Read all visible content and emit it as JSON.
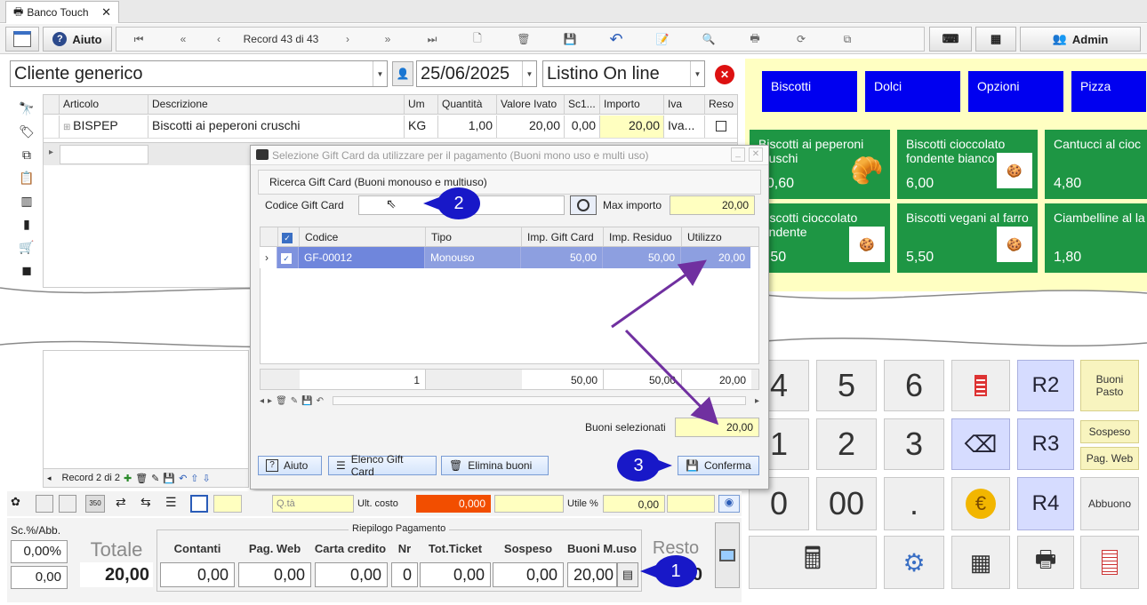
{
  "tab": {
    "title": "Banco Touch",
    "close": "✕"
  },
  "toolbar": {
    "help_label": "Aiuto",
    "record_label": "Record 43 di 43",
    "admin_label": "Admin"
  },
  "customer": {
    "name": "Cliente generico",
    "date": "25/06/2025",
    "pricelist": "Listino On line"
  },
  "grid": {
    "headers": [
      "Articolo",
      "Descrizione",
      "Um",
      "Quantità",
      "Valore Ivato",
      "Sc1...",
      "Importo",
      "Iva",
      "Reso"
    ],
    "row": {
      "articolo": "BISPEP",
      "descrizione": "Biscotti ai peperoni cruschi",
      "um": "KG",
      "quantita": "1,00",
      "valore": "20,00",
      "sc1": "0,00",
      "importo": "20,00",
      "iva": "Iva..."
    }
  },
  "record_footer": "Record 2 di 2",
  "categories": [
    {
      "label": "Biscotti"
    },
    {
      "label": "Dolci"
    },
    {
      "label": "Opzioni"
    },
    {
      "label": "Pizza"
    }
  ],
  "products": [
    {
      "name": "Biscotti ai peperoni cruschi",
      "price": "20,60"
    },
    {
      "name": "Biscotti cioccolato fondente bianco",
      "price": "6,00"
    },
    {
      "name": "Cantucci al cioc",
      "price": "4,80"
    },
    {
      "name": "Biscotti cioccolato fondente",
      "price": "2,50"
    },
    {
      "name": "Biscotti vegani al farro",
      "price": "5,50"
    },
    {
      "name": "Ciambelline al la",
      "price": "1,80"
    }
  ],
  "keypad": {
    "k4": "4",
    "k5": "5",
    "k6": "6",
    "r2": "R2",
    "buoni_pasto": "Buoni Pasto",
    "k1": "1",
    "k2": "2",
    "k3": "3",
    "r3": "R3",
    "sospeso": "Sospeso",
    "pag_web": "Pag. Web",
    "k0": "0",
    "k00": "00",
    "dot": ".",
    "r4": "R4",
    "abbuono": "Abbuono"
  },
  "dialog": {
    "title": "Selezione Gift Card da utilizzare per il pagamento (Buoni mono uso e multi uso)",
    "group_title": "Ricerca Gift Card (Buoni monouso e multiuso)",
    "code_label": "Codice Gift Card",
    "code_value": "",
    "max_label": "Max importo",
    "max_value": "20,00",
    "columns": [
      "Codice",
      "Tipo",
      "Imp. Gift Card",
      "Imp. Residuo",
      "Utilizzo"
    ],
    "row": {
      "codice": "GF-00012",
      "tipo": "Monouso",
      "imp": "50,00",
      "residuo": "50,00",
      "utilizzo": "20,00"
    },
    "totals": {
      "count": "1",
      "imp": "50,00",
      "residuo": "50,00",
      "utilizzo": "20,00"
    },
    "selected_label": "Buoni selezionati",
    "selected_value": "20,00",
    "btn_help": "Aiuto",
    "btn_list": "Elenco Gift Card",
    "btn_delete": "Elimina buoni",
    "btn_confirm": "Conferma"
  },
  "info_row": {
    "qta_label": "Q.tà",
    "ult_costo_label": "Ult. costo",
    "ult_costo_value": "0,000",
    "utile_label": "Utile %",
    "utile_value": "0,00"
  },
  "payment": {
    "section_title": "Riepilogo Pagamento",
    "sc_label": "Sc.%/Abb.",
    "sc_pct": "0,00%",
    "sc_abb": "0,00",
    "totale_label": "Totale",
    "totale_value": "20,00",
    "resto_label": "Resto",
    "resto_value": "0",
    "cols": [
      {
        "label": "Contanti",
        "value": "0,00"
      },
      {
        "label": "Pag. Web",
        "value": "0,00"
      },
      {
        "label": "Carta credito",
        "value": "0,00"
      },
      {
        "label": "Nr",
        "value": "0"
      },
      {
        "label": "Tot.Ticket",
        "value": "0,00"
      },
      {
        "label": "Sospeso",
        "value": "0,00"
      },
      {
        "label": "Buoni M.uso",
        "value": "20,00"
      }
    ]
  },
  "callouts": {
    "c1": "1",
    "c2": "2",
    "c3": "3"
  },
  "colors": {
    "category_blue": "#0000f0",
    "product_green": "#1e9644",
    "callout": "#1818c8",
    "arrow": "#7030a0",
    "highlight_yellow": "#ffffc0"
  }
}
